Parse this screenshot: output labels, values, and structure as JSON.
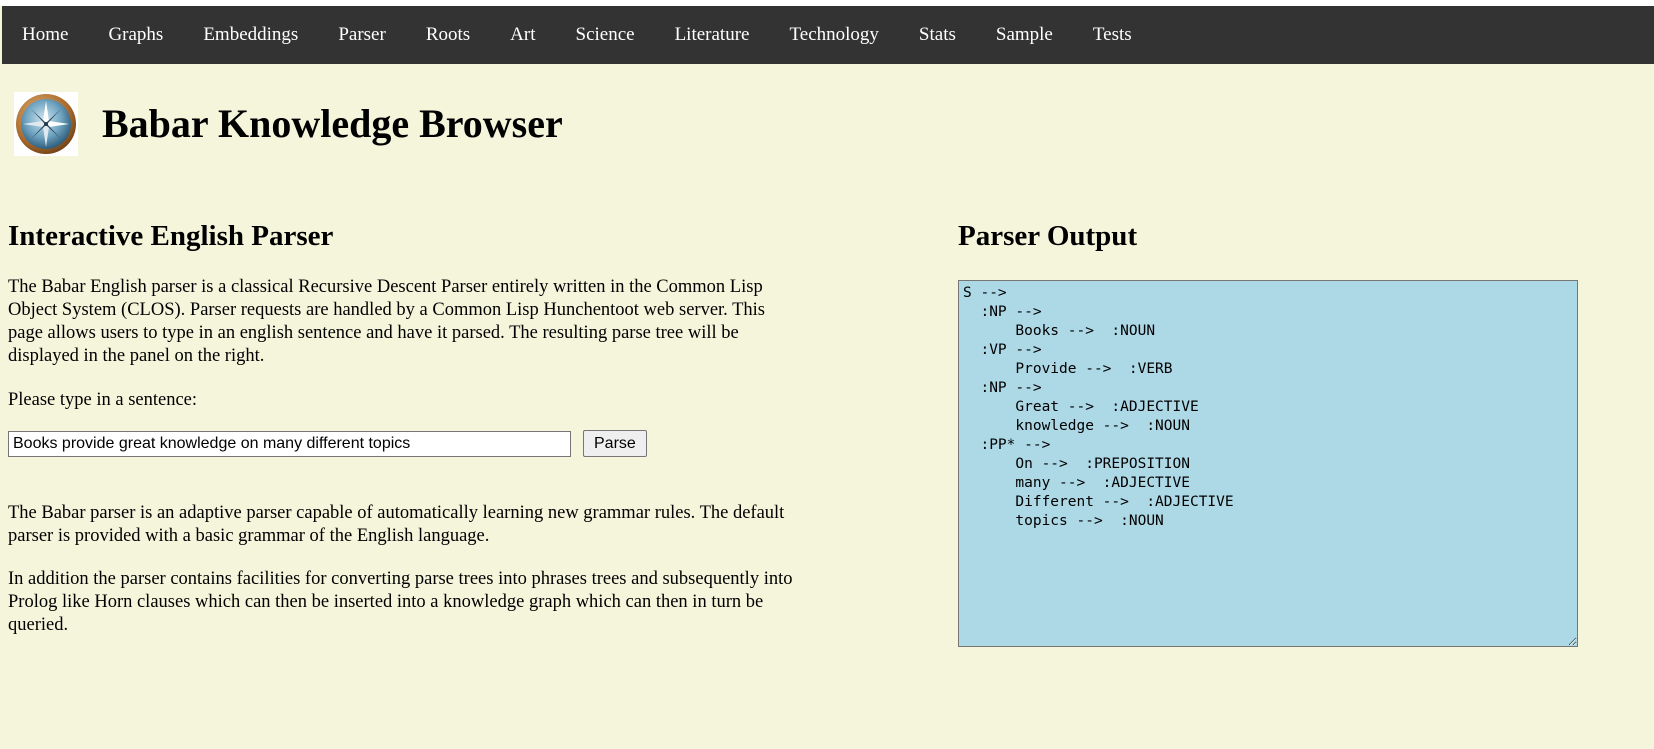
{
  "nav": {
    "items": [
      "Home",
      "Graphs",
      "Embeddings",
      "Parser",
      "Roots",
      "Art",
      "Science",
      "Literature",
      "Technology",
      "Stats",
      "Sample",
      "Tests"
    ]
  },
  "header": {
    "title": "Babar Knowledge Browser",
    "logo_icon": "compass-icon"
  },
  "left": {
    "heading": "Interactive English Parser",
    "intro": "The Babar English parser is a classical Recursive Descent Parser entirely written in the Common Lisp Object System (CLOS). Parser requests are handled by a Common Lisp Hunchentoot web server. This page allows users to type in an english sentence and have it parsed. The resulting parse tree will be displayed in the panel on the right.",
    "prompt": "Please type in a sentence:",
    "input_value": "Books provide great knowledge on many different topics",
    "button_label": "Parse",
    "para2": "The Babar parser is an adaptive parser capable of automatically learning new grammar rules. The default parser is provided with a basic grammar of the English language.",
    "para3": "In addition the parser contains facilities for converting parse trees into phrases trees and subsequently into Prolog like Horn clauses which can then be inserted into a knowledge graph which can then in turn be queried."
  },
  "right": {
    "heading": "Parser Output",
    "output": "S -->\n  :NP -->\n      Books -->  :NOUN\n  :VP -->\n      Provide -->  :VERB\n  :NP -->\n      Great -->  :ADJECTIVE\n      knowledge -->  :NOUN\n  :PP* -->\n      On -->  :PREPOSITION\n      many -->  :ADJECTIVE\n      Different -->  :ADJECTIVE\n      topics -->  :NOUN"
  },
  "colors": {
    "page_bg": "#f5f5dc",
    "navbar_bg": "#333333",
    "output_bg": "#add8e6"
  }
}
